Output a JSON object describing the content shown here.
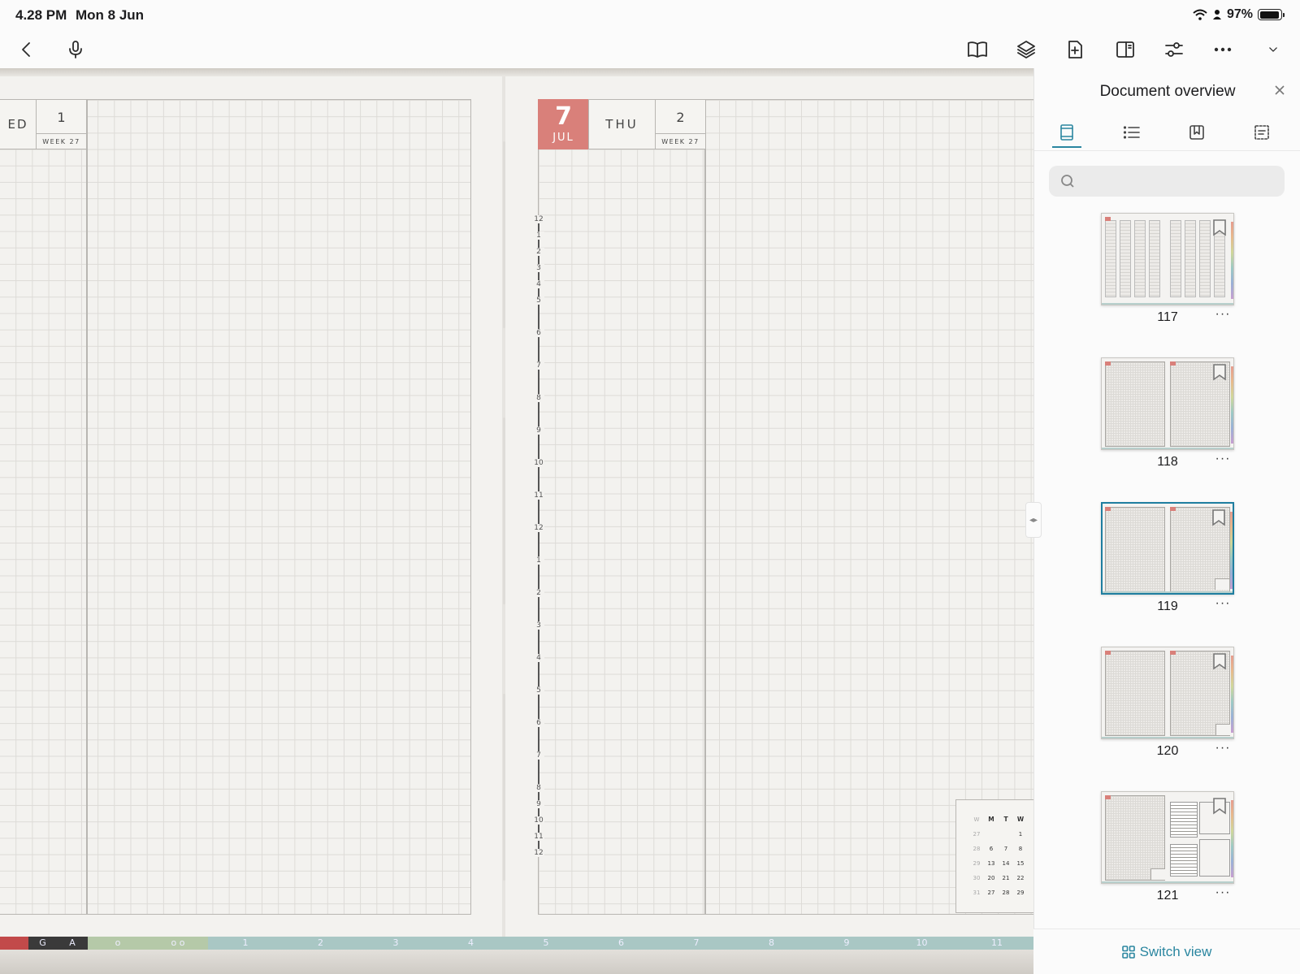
{
  "status_bar": {
    "time": "4.28 PM",
    "date": "Mon 8 Jun",
    "battery": "97%",
    "icons": [
      "wifi-icon",
      "person-icon",
      "battery-icon"
    ]
  },
  "toolbar": {
    "left": [
      "back-chevron-icon",
      "microphone-icon"
    ],
    "right": [
      "book-icon",
      "layers-icon",
      "add-page-icon",
      "split-view-icon",
      "sliders-icon",
      "more-icon",
      "chevron-down-icon"
    ]
  },
  "planner": {
    "left_page": {
      "day_fragment": "ED",
      "day_of_year": "1",
      "week_label": "WEEK 27"
    },
    "right_page": {
      "day": "7",
      "month": "JUL",
      "weekday": "THU",
      "day_of_year": "2",
      "week_label": "WEEK 27",
      "accent_color": "#d9807a",
      "time_labels": [
        "12",
        "1",
        "2",
        "3",
        "4",
        "5",
        "6",
        "7",
        "8",
        "9",
        "10",
        "11",
        "12",
        "1",
        "2",
        "3",
        "4",
        "5",
        "6",
        "7",
        "8",
        "9",
        "10",
        "11",
        "12"
      ]
    },
    "mini_calendar": {
      "headers": [
        "W",
        "M",
        "T",
        "W"
      ],
      "rows": [
        [
          "27",
          "",
          "",
          "1"
        ],
        [
          "28",
          "6",
          "7",
          "8"
        ],
        [
          "29",
          "13",
          "14",
          "15"
        ],
        [
          "30",
          "20",
          "21",
          "22"
        ],
        [
          "31",
          "27",
          "28",
          "29"
        ]
      ]
    },
    "tabs": [
      "G",
      "A",
      "o",
      "o o",
      "1",
      "2",
      "3",
      "4",
      "5",
      "6",
      "7",
      "8",
      "9",
      "10",
      "11"
    ]
  },
  "panel": {
    "title": "Document overview",
    "tabs": [
      "thumbnails-tab",
      "outline-tab",
      "bookmarks-tab",
      "annotations-tab"
    ],
    "active_tab": "thumbnails-tab",
    "search_placeholder": "",
    "accent": "#2a86a0",
    "thumbnails": [
      {
        "page": "117",
        "selected": false
      },
      {
        "page": "118",
        "selected": false
      },
      {
        "page": "119",
        "selected": true
      },
      {
        "page": "120",
        "selected": false
      },
      {
        "page": "121",
        "selected": false
      }
    ],
    "more_label": "···",
    "switch_view_label": "Switch view"
  }
}
